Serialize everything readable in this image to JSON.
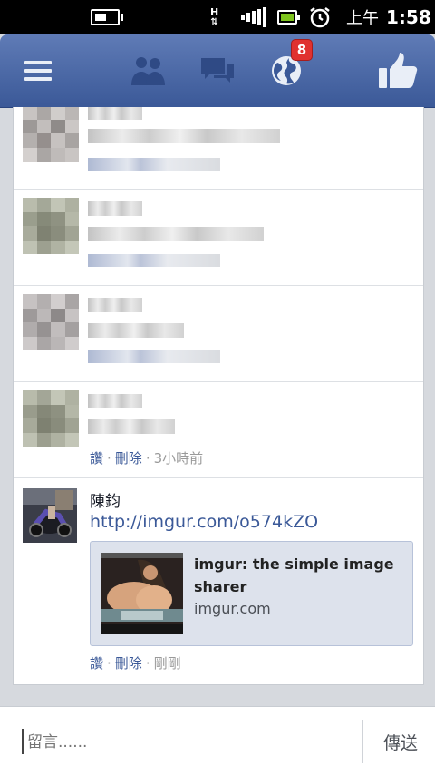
{
  "status_bar": {
    "network_type": "H",
    "time_period": "上午",
    "time": "1:58",
    "icons": [
      "battery-wide-icon",
      "network-arrows-icon",
      "signal-icon",
      "battery-icon",
      "alarm-icon"
    ]
  },
  "nav": {
    "icons": [
      "menu-icon",
      "friends-icon",
      "messages-icon",
      "notifications-globe-icon",
      "like-icon"
    ],
    "notification_count": "8",
    "colors": {
      "bar": "#3b5998",
      "badge": "#e0312f"
    }
  },
  "comments": [
    {
      "actions": {
        "like": "讚",
        "delete": "刪除",
        "time": "3小時前"
      }
    }
  ],
  "latest_comment": {
    "author": "陳鈞",
    "link_text": "http://imgur.com/o574kZO",
    "preview": {
      "title": "imgur: the simple image sharer",
      "domain": "imgur.com"
    },
    "actions": {
      "like": "讚",
      "delete": "刪除",
      "time": "剛剛"
    }
  },
  "composer": {
    "placeholder": "留言......",
    "send_label": "傳送"
  }
}
